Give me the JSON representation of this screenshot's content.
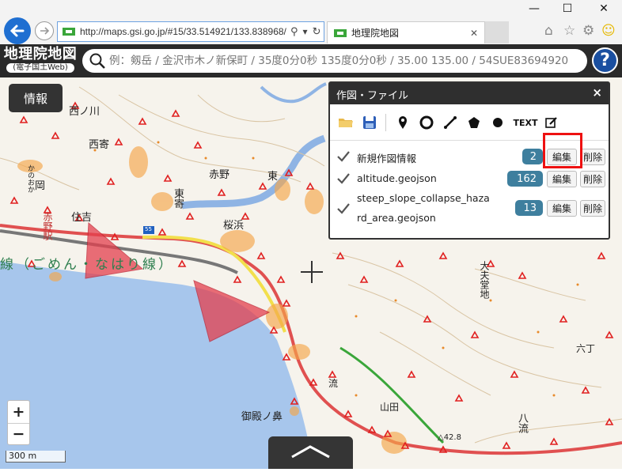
{
  "browser": {
    "url": "http://maps.gsi.go.jp/#15/33.514921/133.838968/",
    "tab_title": "地理院地図",
    "window_controls": [
      "minimize",
      "maximize",
      "close"
    ]
  },
  "app": {
    "logo_title": "地理院地図",
    "logo_subtitle": "(電子国土Web)",
    "search_placeholder": "例：剱岳 / 金沢市木ノ新保町 / 35度0分0秒 135度0分0秒 / 35.00 135.00 / 54SUE83694920",
    "help_label": "?",
    "info_button": "情報"
  },
  "panel": {
    "title": "作図・ファイル",
    "close_label": "×",
    "tools": [
      "folder-open-icon",
      "save-icon",
      "marker-icon",
      "circle-icon",
      "line-icon",
      "polygon-icon",
      "dot-icon",
      "text-tool",
      "edit-icon"
    ],
    "text_tool_label": "TEXT",
    "layers": [
      {
        "name": "新規作図情報",
        "count": "2",
        "edit": "編集",
        "delete": "削除",
        "checked": true
      },
      {
        "name": "altitude.geojson",
        "count": "162",
        "edit": "編集",
        "delete": "削除",
        "checked": true
      },
      {
        "name_line1": "steep_slope_collapse_haza",
        "name_line2": "rd_area.geojson",
        "count": "13",
        "edit": "編集",
        "delete": "削除",
        "checked": true
      }
    ]
  },
  "map": {
    "labels": {
      "nishi": "西ノ川",
      "nishiyo": "西寄",
      "kanoka": "かのおか",
      "oka": "岡",
      "sumiyoshi": "住吉",
      "akano": "赤野",
      "akano_sta": "赤野駅",
      "higashiyose": "東寄",
      "sakurahama": "桜浜",
      "higashi": "東",
      "akano2": "赤野",
      "line_name": "線（ごめん・なはり線）",
      "ootai": "大夫堂地",
      "goten": "御殿ノ鼻",
      "yamada": "山田",
      "hachiryu": "八流",
      "rokuchou": "六丁",
      "nagare": "流",
      "spot": "△42.8",
      "route55": "55"
    },
    "zoom_in": "+",
    "zoom_out": "−",
    "scale_label": "300 m"
  }
}
